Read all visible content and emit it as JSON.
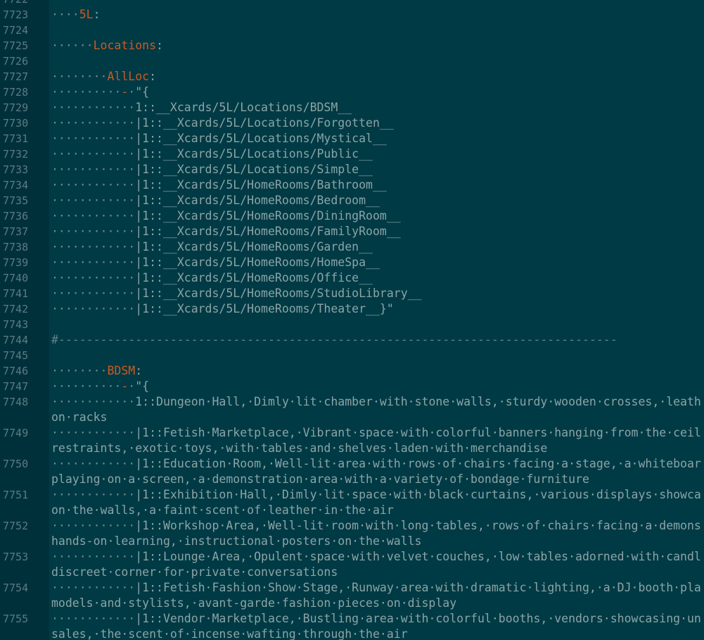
{
  "editor": {
    "lines": [
      {
        "num": "7722",
        "rows": [
          {
            "segs": []
          }
        ]
      },
      {
        "num": "7723",
        "rows": [
          {
            "segs": [
              {
                "t": "····",
                "c": "dot"
              },
              {
                "t": "5L",
                "c": "key"
              },
              {
                "t": ":",
                "c": "punct"
              }
            ]
          }
        ]
      },
      {
        "num": "7724",
        "rows": [
          {
            "segs": []
          }
        ]
      },
      {
        "num": "7725",
        "rows": [
          {
            "segs": [
              {
                "t": "······",
                "c": "dot"
              },
              {
                "t": "Locations",
                "c": "key"
              },
              {
                "t": ":",
                "c": "punct"
              }
            ]
          }
        ]
      },
      {
        "num": "7726",
        "rows": [
          {
            "segs": []
          }
        ]
      },
      {
        "num": "7727",
        "rows": [
          {
            "segs": [
              {
                "t": "········",
                "c": "dot"
              },
              {
                "t": "AllLoc",
                "c": "key"
              },
              {
                "t": ":",
                "c": "punct"
              }
            ]
          }
        ]
      },
      {
        "num": "7728",
        "rows": [
          {
            "segs": [
              {
                "t": "··········",
                "c": "dot"
              },
              {
                "t": "-",
                "c": "key"
              },
              {
                "t": "·",
                "c": "dot"
              },
              {
                "t": "\"{",
                "c": "punct"
              }
            ]
          }
        ]
      },
      {
        "num": "7729",
        "rows": [
          {
            "segs": [
              {
                "t": "············",
                "c": "dot"
              },
              {
                "t": "1::__Xcards/5L/Locations/BDSM__",
                "c": "punct"
              }
            ]
          }
        ]
      },
      {
        "num": "7730",
        "rows": [
          {
            "segs": [
              {
                "t": "············",
                "c": "dot"
              },
              {
                "t": "|1::__Xcards/5L/Locations/Forgotten__",
                "c": "punct"
              }
            ]
          }
        ]
      },
      {
        "num": "7731",
        "rows": [
          {
            "segs": [
              {
                "t": "············",
                "c": "dot"
              },
              {
                "t": "|1::__Xcards/5L/Locations/Mystical__",
                "c": "punct"
              }
            ]
          }
        ]
      },
      {
        "num": "7732",
        "rows": [
          {
            "segs": [
              {
                "t": "············",
                "c": "dot"
              },
              {
                "t": "|1::__Xcards/5L/Locations/Public__",
                "c": "punct"
              }
            ]
          }
        ]
      },
      {
        "num": "7733",
        "rows": [
          {
            "segs": [
              {
                "t": "············",
                "c": "dot"
              },
              {
                "t": "|1::__Xcards/5L/Locations/Simple__",
                "c": "punct"
              }
            ]
          }
        ]
      },
      {
        "num": "7734",
        "rows": [
          {
            "segs": [
              {
                "t": "············",
                "c": "dot"
              },
              {
                "t": "|1::__Xcards/5L/HomeRooms/Bathroom__",
                "c": "punct"
              }
            ]
          }
        ]
      },
      {
        "num": "7735",
        "rows": [
          {
            "segs": [
              {
                "t": "············",
                "c": "dot"
              },
              {
                "t": "|1::__Xcards/5L/HomeRooms/Bedroom__",
                "c": "punct"
              }
            ]
          }
        ]
      },
      {
        "num": "7736",
        "rows": [
          {
            "segs": [
              {
                "t": "············",
                "c": "dot"
              },
              {
                "t": "|1::__Xcards/5L/HomeRooms/DiningRoom__",
                "c": "punct"
              }
            ]
          }
        ]
      },
      {
        "num": "7737",
        "rows": [
          {
            "segs": [
              {
                "t": "············",
                "c": "dot"
              },
              {
                "t": "|1::__Xcards/5L/HomeRooms/FamilyRoom__",
                "c": "punct"
              }
            ]
          }
        ]
      },
      {
        "num": "7738",
        "rows": [
          {
            "segs": [
              {
                "t": "············",
                "c": "dot"
              },
              {
                "t": "|1::__Xcards/5L/HomeRooms/Garden__",
                "c": "punct"
              }
            ]
          }
        ]
      },
      {
        "num": "7739",
        "rows": [
          {
            "segs": [
              {
                "t": "············",
                "c": "dot"
              },
              {
                "t": "|1::__Xcards/5L/HomeRooms/HomeSpa__",
                "c": "punct"
              }
            ]
          }
        ]
      },
      {
        "num": "7740",
        "rows": [
          {
            "segs": [
              {
                "t": "············",
                "c": "dot"
              },
              {
                "t": "|1::__Xcards/5L/HomeRooms/Office__",
                "c": "punct"
              }
            ]
          }
        ]
      },
      {
        "num": "7741",
        "rows": [
          {
            "segs": [
              {
                "t": "············",
                "c": "dot"
              },
              {
                "t": "|1::__Xcards/5L/HomeRooms/StudioLibrary__",
                "c": "punct"
              }
            ]
          }
        ]
      },
      {
        "num": "7742",
        "rows": [
          {
            "segs": [
              {
                "t": "············",
                "c": "dot"
              },
              {
                "t": "|1::__Xcards/5L/HomeRooms/Theater__}\"",
                "c": "punct"
              }
            ]
          }
        ]
      },
      {
        "num": "7743",
        "rows": [
          {
            "segs": []
          }
        ]
      },
      {
        "num": "7744",
        "rows": [
          {
            "segs": [
              {
                "t": "#--------------------------------------------------------------------------------",
                "c": "comment"
              }
            ]
          }
        ]
      },
      {
        "num": "7745",
        "rows": [
          {
            "segs": []
          }
        ]
      },
      {
        "num": "7746",
        "rows": [
          {
            "segs": [
              {
                "t": "········",
                "c": "dot"
              },
              {
                "t": "BDSM",
                "c": "key"
              },
              {
                "t": ":",
                "c": "punct"
              }
            ]
          }
        ]
      },
      {
        "num": "7747",
        "rows": [
          {
            "segs": [
              {
                "t": "··········",
                "c": "dot"
              },
              {
                "t": "-",
                "c": "key"
              },
              {
                "t": "·",
                "c": "dot"
              },
              {
                "t": "\"{",
                "c": "punct"
              }
            ]
          }
        ]
      },
      {
        "num": "7748",
        "rows": [
          {
            "segs": [
              {
                "t": "············",
                "c": "dot"
              },
              {
                "t": "1::Dungeon·Hall,·Dimly·lit·chamber·with·stone·walls,·sturdy·wooden·crosses,·leath",
                "c": "punct"
              }
            ]
          },
          {
            "segs": [
              {
                "t": "on·racks",
                "c": "punct"
              }
            ]
          }
        ]
      },
      {
        "num": "7749",
        "rows": [
          {
            "segs": [
              {
                "t": "············",
                "c": "dot"
              },
              {
                "t": "|1::Fetish·Marketplace,·Vibrant·space·with·colorful·banners·hanging·from·the·ceil",
                "c": "punct"
              }
            ]
          },
          {
            "segs": [
              {
                "t": "restraints,·exotic·toys,·with·tables·and·shelves·laden·with·merchandise",
                "c": "punct"
              }
            ]
          }
        ]
      },
      {
        "num": "7750",
        "rows": [
          {
            "segs": [
              {
                "t": "············",
                "c": "dot"
              },
              {
                "t": "|1::Education·Room,·Well-lit·area·with·rows·of·chairs·facing·a·stage,·a·whiteboar",
                "c": "punct"
              }
            ]
          },
          {
            "segs": [
              {
                "t": "playing·on·a·screen,·a·demonstration·area·with·a·variety·of·bondage·furniture",
                "c": "punct"
              }
            ]
          }
        ]
      },
      {
        "num": "7751",
        "rows": [
          {
            "segs": [
              {
                "t": "············",
                "c": "dot"
              },
              {
                "t": "|1::Exhibition·Hall,·Dimly·lit·space·with·black·curtains,·various·displays·showca",
                "c": "punct"
              }
            ]
          },
          {
            "segs": [
              {
                "t": "on·the·walls,·a·faint·scent·of·leather·in·the·air",
                "c": "punct"
              }
            ]
          }
        ]
      },
      {
        "num": "7752",
        "rows": [
          {
            "segs": [
              {
                "t": "············",
                "c": "dot"
              },
              {
                "t": "|1::Workshop·Area,·Well-lit·room·with·long·tables,·rows·of·chairs·facing·a·demons",
                "c": "punct"
              }
            ]
          },
          {
            "segs": [
              {
                "t": "hands-on·learning,·instructional·posters·on·the·walls",
                "c": "punct"
              }
            ]
          }
        ]
      },
      {
        "num": "7753",
        "rows": [
          {
            "segs": [
              {
                "t": "············",
                "c": "dot"
              },
              {
                "t": "|1::Lounge·Area,·Opulent·space·with·velvet·couches,·low·tables·adorned·with·candl",
                "c": "punct"
              }
            ]
          },
          {
            "segs": [
              {
                "t": "discreet·corner·for·private·conversations",
                "c": "punct"
              }
            ]
          }
        ]
      },
      {
        "num": "7754",
        "rows": [
          {
            "segs": [
              {
                "t": "············",
                "c": "dot"
              },
              {
                "t": "|1::Fetish·Fashion·Show·Stage,·Runway·area·with·dramatic·lighting,·a·DJ·booth·pla",
                "c": "punct"
              }
            ]
          },
          {
            "segs": [
              {
                "t": "models·and·stylists,·avant-garde·fashion·pieces·on·display",
                "c": "punct"
              }
            ]
          }
        ]
      },
      {
        "num": "7755",
        "rows": [
          {
            "segs": [
              {
                "t": "············",
                "c": "dot"
              },
              {
                "t": "|1::Vendor·Marketplace,·Bustling·area·with·colorful·booths,·vendors·showcasing·un",
                "c": "punct"
              }
            ]
          },
          {
            "segs": [
              {
                "t": "sales,·the·scent·of·incense·wafting·through·the·air",
                "c": "punct"
              }
            ]
          }
        ]
      }
    ]
  },
  "colors": {
    "gutter_bg": "#00313b",
    "code_bg": "#003a45",
    "line_number": "#5e7a82",
    "text": "#8ba5a6",
    "key": "#cb5a22",
    "whitespace_dot": "#6d8c92"
  }
}
